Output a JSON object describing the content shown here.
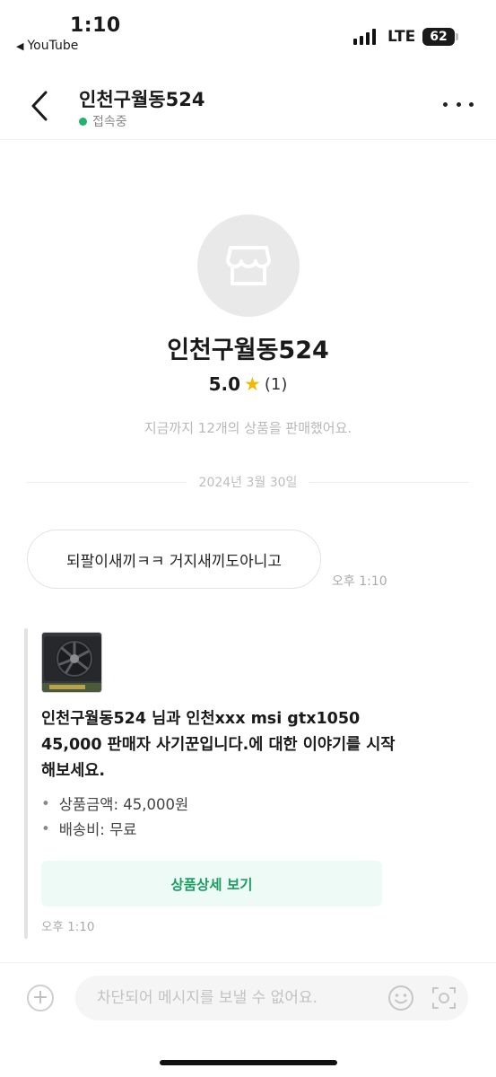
{
  "status_bar": {
    "time": "1:10",
    "back_app": "YouTube",
    "network": "LTE",
    "battery": "62"
  },
  "header": {
    "title": "인천구월동524",
    "status": "접속중"
  },
  "profile": {
    "name": "인천구월동524",
    "rating": "5.0",
    "review_count": "(1)",
    "sales_note": "지금까지 12개의 상품을 판매했어요."
  },
  "date_divider": "2024년 3월 30일",
  "message": {
    "text": "되팔이새끼ㅋㅋ 거지새끼도아니고",
    "time": "오후 1:10"
  },
  "product_card": {
    "text": "인천구월동524 님과 인천xxx msi gtx1050 45,000 판매자 사기꾼입니다.에 대한 이야기를 시작해보세요.",
    "price": "상품금액: 45,000원",
    "shipping": "배송비: 무료",
    "detail_button": "상품상세 보기",
    "time": "오후 1:10"
  },
  "input": {
    "placeholder": "차단되어 메시지를 보낼 수 없어요."
  },
  "colors": {
    "online": "#23b26d",
    "accent_text": "#1a9e63",
    "accent_bg": "#eefaf5",
    "star": "#f5b800"
  },
  "icons": [
    "back-chevron-icon",
    "more-dots-icon",
    "store-icon",
    "star-icon",
    "plus-icon",
    "emoji-icon",
    "camera-icon"
  ]
}
